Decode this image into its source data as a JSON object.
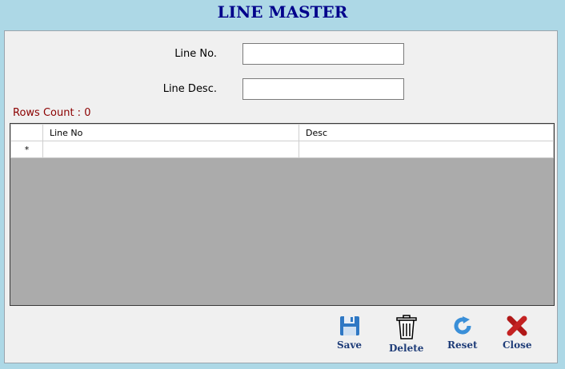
{
  "window": {
    "title": "LINE MASTER"
  },
  "form": {
    "line_no_label": "Line No.",
    "line_no_value": "",
    "line_desc_label": "Line Desc.",
    "line_desc_value": ""
  },
  "rows_count": "Rows Count : 0",
  "grid": {
    "columns": [
      "Line No",
      "Desc"
    ],
    "new_row_marker": "*",
    "rows": []
  },
  "toolbar": {
    "save_label": "Save",
    "delete_label": "Delete",
    "reset_label": "Reset",
    "close_label": "Close"
  },
  "icons": {
    "save": "floppy-disk-icon",
    "delete": "trash-can-icon",
    "reset": "refresh-icon",
    "close": "red-x-icon"
  },
  "colors": {
    "background": "#add8e6",
    "title": "#00008b",
    "rows_count": "#8b0000",
    "grid_empty": "#ababab",
    "button_text": "#1e3c78"
  }
}
